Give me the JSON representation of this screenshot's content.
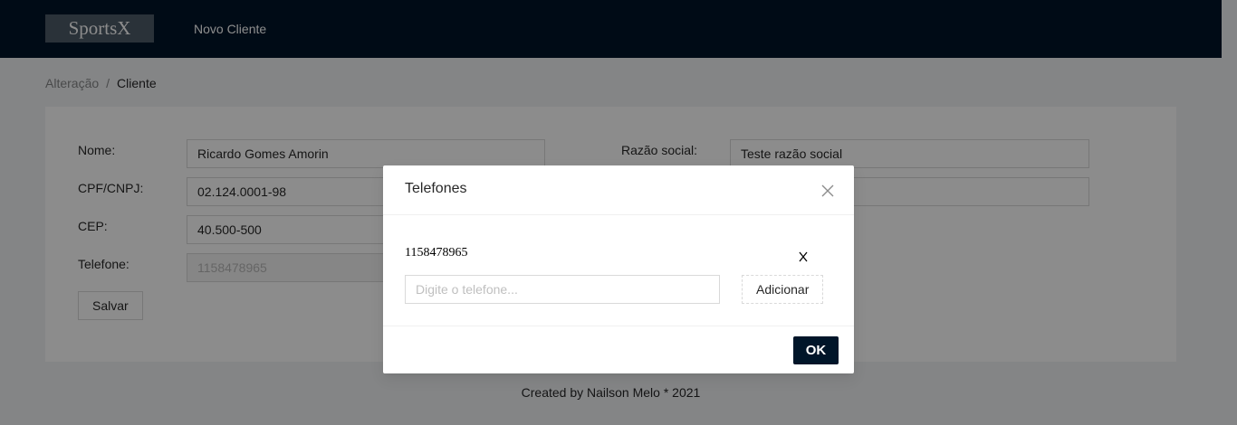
{
  "header": {
    "logo": "SportsX",
    "nav": [
      {
        "label": "Novo Cliente"
      }
    ]
  },
  "breadcrumb": {
    "items": [
      "Alteração",
      "Cliente"
    ],
    "separator": "/"
  },
  "form": {
    "nome": {
      "label": "Nome:",
      "value": "Ricardo Gomes Amorin"
    },
    "cpf": {
      "label": "CPF/CNPJ:",
      "value": "02.124.0001-98"
    },
    "cep": {
      "label": "CEP:",
      "value": "40.500-500"
    },
    "telefone": {
      "label": "Telefone:",
      "value": "1158478965"
    },
    "razao": {
      "label": "Razão social:",
      "value": "Teste razão social"
    },
    "save_label": "Salvar"
  },
  "footer": {
    "text": "Created by Nailson Melo * 2021"
  },
  "modal": {
    "title": "Telefones",
    "phones": [
      "1158478965"
    ],
    "remove_label": "X",
    "input_placeholder": "Digite o telefone...",
    "add_label": "Adicionar",
    "ok_label": "OK"
  },
  "colors": {
    "header_bg": "#001529",
    "primary_button": "#001529"
  },
  "icons": {
    "close": "close-icon"
  }
}
